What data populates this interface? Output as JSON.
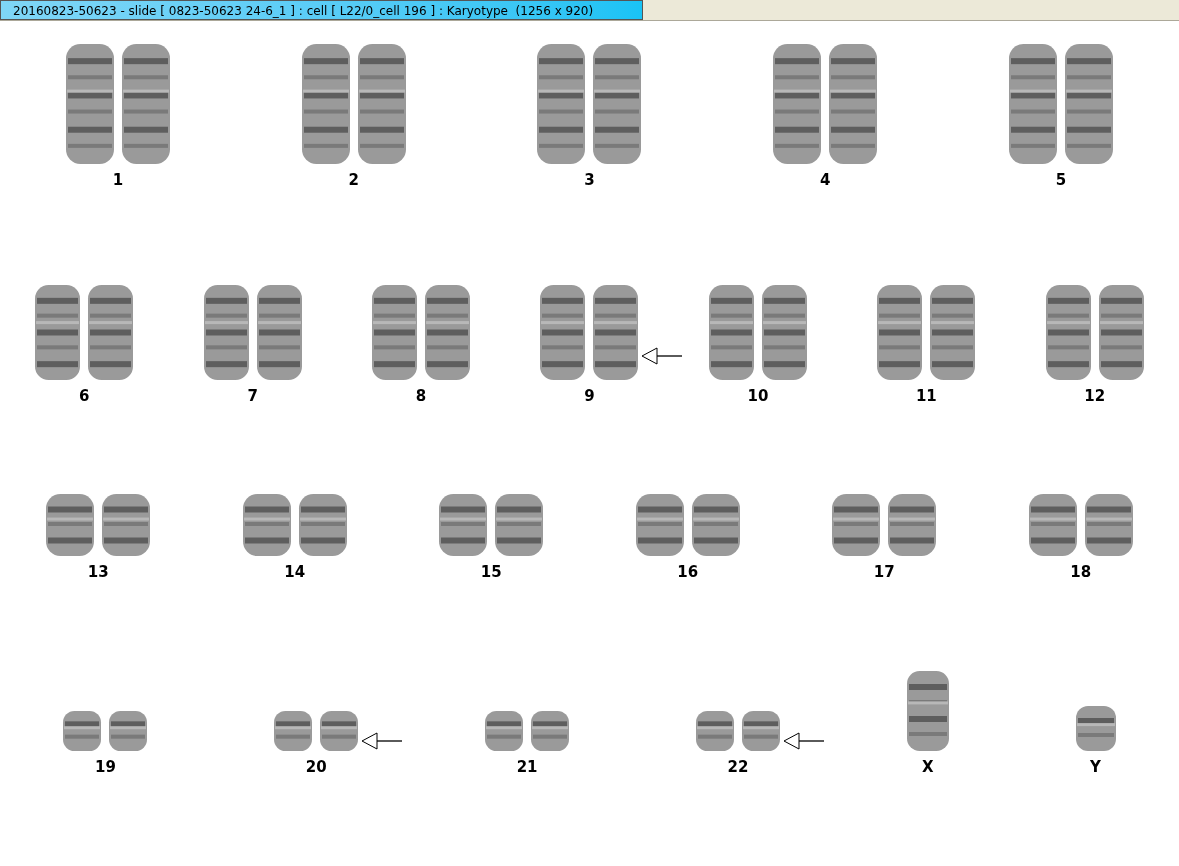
{
  "window": {
    "title": "20160823-50623 - slide [ 0823-50623 24-6_1 ] : cell [ L22/0_cell 196 ] : Karyotype  (1256 x 920)"
  },
  "karyotype": {
    "rows": [
      {
        "items": [
          {
            "label": "1",
            "kind": "pair",
            "arrow": false
          },
          {
            "label": "2",
            "kind": "pair",
            "arrow": false
          },
          {
            "label": "3",
            "kind": "pair",
            "arrow": false
          },
          {
            "label": "4",
            "kind": "pair",
            "arrow": false
          },
          {
            "label": "5",
            "kind": "pair",
            "arrow": false
          }
        ]
      },
      {
        "items": [
          {
            "label": "6",
            "kind": "pair",
            "arrow": false
          },
          {
            "label": "7",
            "kind": "pair",
            "arrow": false
          },
          {
            "label": "8",
            "kind": "pair",
            "arrow": false
          },
          {
            "label": "9",
            "kind": "pair",
            "arrow": true
          },
          {
            "label": "10",
            "kind": "pair",
            "arrow": false
          },
          {
            "label": "11",
            "kind": "pair",
            "arrow": false
          },
          {
            "label": "12",
            "kind": "pair",
            "arrow": false
          }
        ]
      },
      {
        "items": [
          {
            "label": "13",
            "kind": "pair",
            "arrow": false
          },
          {
            "label": "14",
            "kind": "pair",
            "arrow": false
          },
          {
            "label": "15",
            "kind": "pair",
            "arrow": false
          },
          {
            "label": "16",
            "kind": "pair",
            "arrow": false
          },
          {
            "label": "17",
            "kind": "pair",
            "arrow": false
          },
          {
            "label": "18",
            "kind": "pair",
            "arrow": false
          }
        ]
      },
      {
        "items": [
          {
            "label": "19",
            "kind": "pair",
            "arrow": false
          },
          {
            "label": "20",
            "kind": "pair",
            "arrow": true
          },
          {
            "label": "21",
            "kind": "pair",
            "arrow": false
          },
          {
            "label": "22",
            "kind": "pair",
            "arrow": true
          },
          {
            "label": "X",
            "kind": "single",
            "arrow": false
          },
          {
            "label": "Y",
            "kind": "single",
            "arrow": false
          }
        ]
      }
    ]
  }
}
